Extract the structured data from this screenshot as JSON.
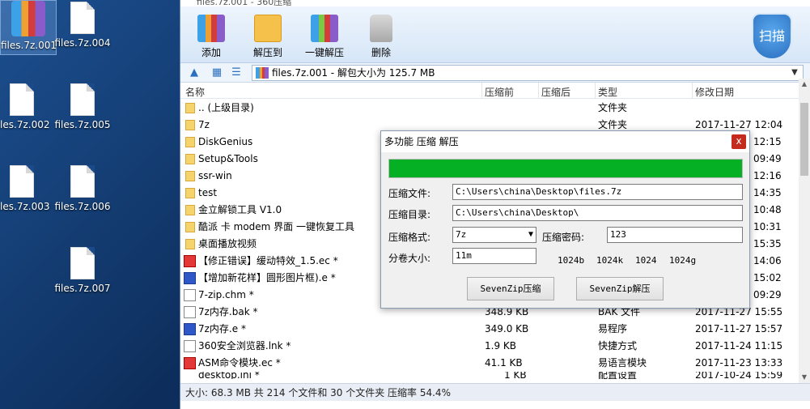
{
  "desktop": {
    "icons": [
      {
        "label": "files.7z.001"
      },
      {
        "label": "files.7z.004"
      },
      {
        "label": "files.7z.002"
      },
      {
        "label": "files.7z.005"
      },
      {
        "label": "files.7z.003"
      },
      {
        "label": "files.7z.006"
      },
      {
        "label": "files.7z.007"
      }
    ]
  },
  "window": {
    "title": "files.7z.001 - 360压缩",
    "toolbar": {
      "add": "添加",
      "extract_to": "解压到",
      "one_click": "一键解压",
      "delete": "删除",
      "scan": "扫描"
    },
    "address": "files.7z.001 - 解包大小为 125.7 MB",
    "columns": {
      "name": "名称",
      "packed": "压缩前",
      "unpacked": "压缩后",
      "type": "类型",
      "modified": "修改日期"
    },
    "rows": [
      {
        "name": ".. (上级目录)",
        "packed": "",
        "type": "文件夹",
        "modified": ""
      },
      {
        "name": "7z",
        "packed": "",
        "type": "文件夹",
        "modified": "2017-11-27 12:04"
      },
      {
        "name": "DiskGenius",
        "packed": "",
        "type": "",
        "modified": "12:15"
      },
      {
        "name": "Setup&Tools",
        "packed": "",
        "type": "",
        "modified": "09:49"
      },
      {
        "name": "ssr-win",
        "packed": "",
        "type": "",
        "modified": "12:16"
      },
      {
        "name": "test",
        "packed": "",
        "type": "",
        "modified": "14:35"
      },
      {
        "name": "金立解锁工具 V1.0",
        "packed": "",
        "type": "",
        "modified": "10:48"
      },
      {
        "name": "酷派 卡 modem 界面 一键恢复工具",
        "packed": "",
        "type": "",
        "modified": "10:31"
      },
      {
        "name": "桌面播放视频",
        "packed": "",
        "type": "",
        "modified": "15:35"
      },
      {
        "name": "【修正错误】缓动特效_1.5.ec *",
        "packed": "",
        "type": "",
        "modified": "14:06"
      },
      {
        "name": "【增加新花样】圆形图片框).e *",
        "packed": "",
        "type": "",
        "modified": "15:02"
      },
      {
        "name": "7-zip.chm *",
        "packed": "",
        "type": "",
        "modified": "09:29"
      },
      {
        "name": "7z内存.bak *",
        "packed": "348.9 KB",
        "type": "BAK 文件",
        "modified": "2017-11-27 15:55"
      },
      {
        "name": "7z内存.e *",
        "packed": "349.0 KB",
        "type": "易程序",
        "modified": "2017-11-27 15:57"
      },
      {
        "name": "360安全浏览器.lnk *",
        "packed": "1.9 KB",
        "type": "快捷方式",
        "modified": "2017-11-24 11:15"
      },
      {
        "name": "ASM命令模块.ec *",
        "packed": "41.1 KB",
        "type": "易语言模块",
        "modified": "2017-11-23 13:33"
      },
      {
        "name": "desktop.ini *",
        "packed": "1 KB",
        "type": "配置设置",
        "modified": "2017-10-24 15:59"
      }
    ],
    "status": "大小: 68.3 MB 共 214 个文件和 30 个文件夹 压缩率 54.4%"
  },
  "dialog": {
    "title": "多功能 压缩 解压",
    "close": "x",
    "progress": 1.0,
    "progress_color": "#06b025",
    "file_label": "压缩文件:",
    "file_value": "C:\\Users\\china\\Desktop\\files.7z",
    "dir_label": "压缩目录:",
    "dir_value": "C:\\Users\\china\\Desktop\\",
    "format_label": "压缩格式:",
    "format_value": "7z",
    "password_label": "压缩密码:",
    "password_value": "123",
    "volume_label": "分卷大小:",
    "volume_value": "11m",
    "size_options": [
      "1024b",
      "1024k",
      "1024",
      "1024g"
    ],
    "compress_btn": "SevenZip压缩",
    "extract_btn": "SevenZip解压"
  }
}
